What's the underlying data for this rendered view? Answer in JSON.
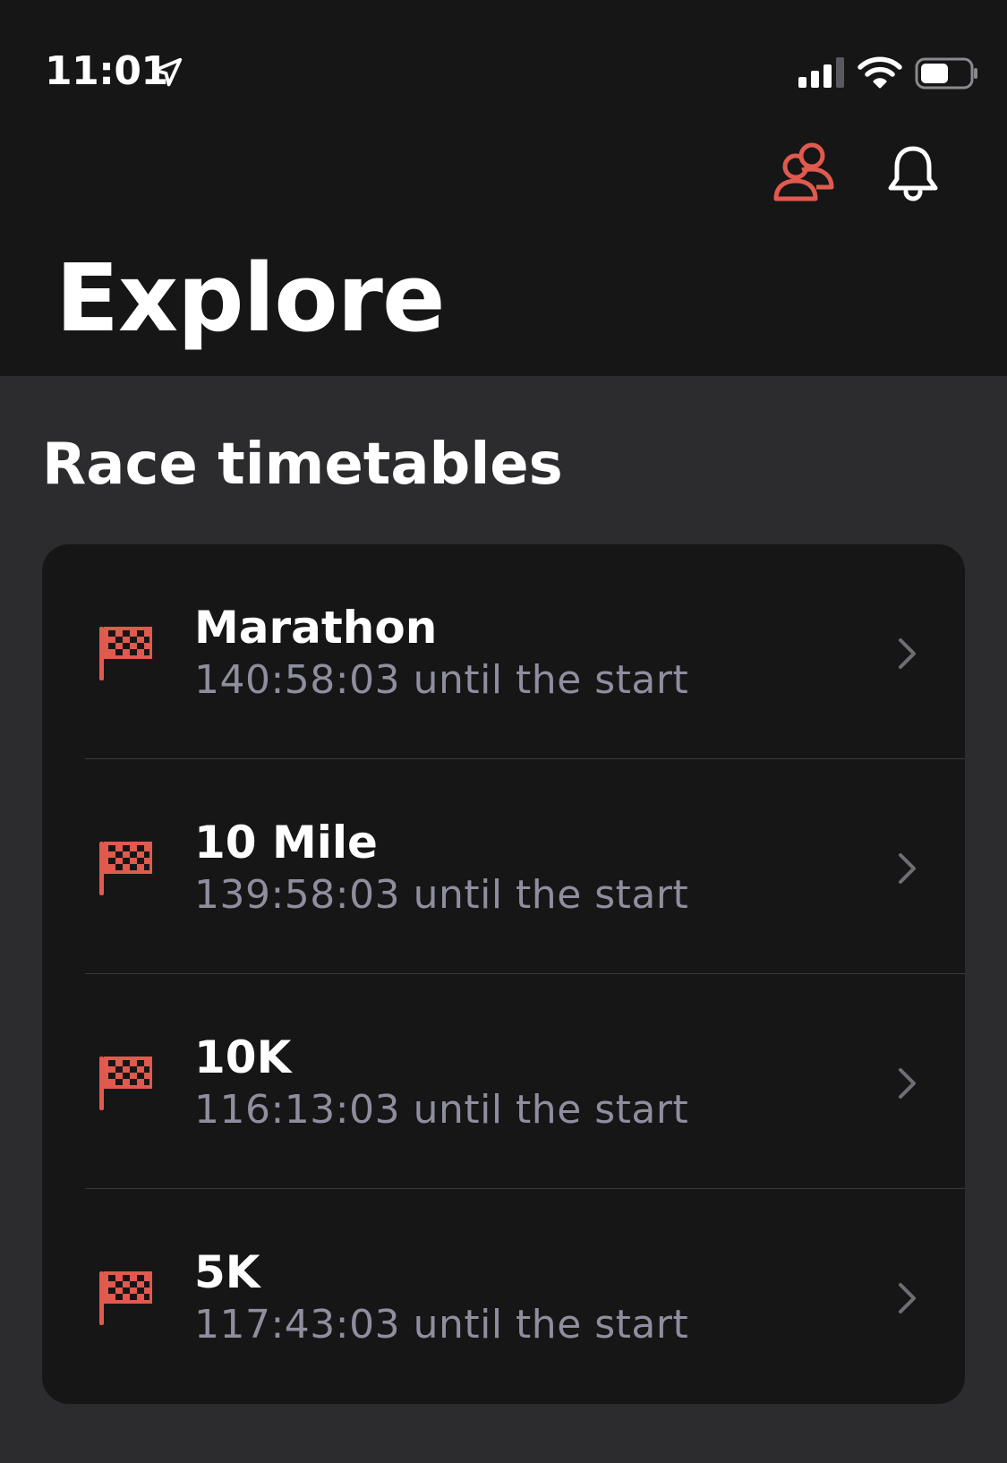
{
  "status_bar": {
    "time": "11:01",
    "icons": [
      "location-arrow-icon",
      "cellular-signal-icon",
      "wifi-icon",
      "battery-icon"
    ]
  },
  "header": {
    "actions": [
      {
        "icon": "friends-icon",
        "color": "#e05a4e"
      },
      {
        "icon": "bell-icon",
        "color": "#ffffff"
      }
    ],
    "title": "Explore"
  },
  "section": {
    "title": "Race timetables"
  },
  "races": [
    {
      "name": "Marathon",
      "countdown": "140:58:03 until the start",
      "icon": "checkered-flag-icon"
    },
    {
      "name": "10 Mile",
      "countdown": "139:58:03 until the start",
      "icon": "checkered-flag-icon"
    },
    {
      "name": "10K",
      "countdown": "116:13:03 until the start",
      "icon": "checkered-flag-icon"
    },
    {
      "name": "5K",
      "countdown": "117:43:03 until the start",
      "icon": "checkered-flag-icon"
    }
  ],
  "colors": {
    "accent": "#e05a4e",
    "background": "#2c2c2e",
    "header_background": "#161617",
    "card_background": "#161617",
    "secondary_text": "#8e8e9e"
  }
}
